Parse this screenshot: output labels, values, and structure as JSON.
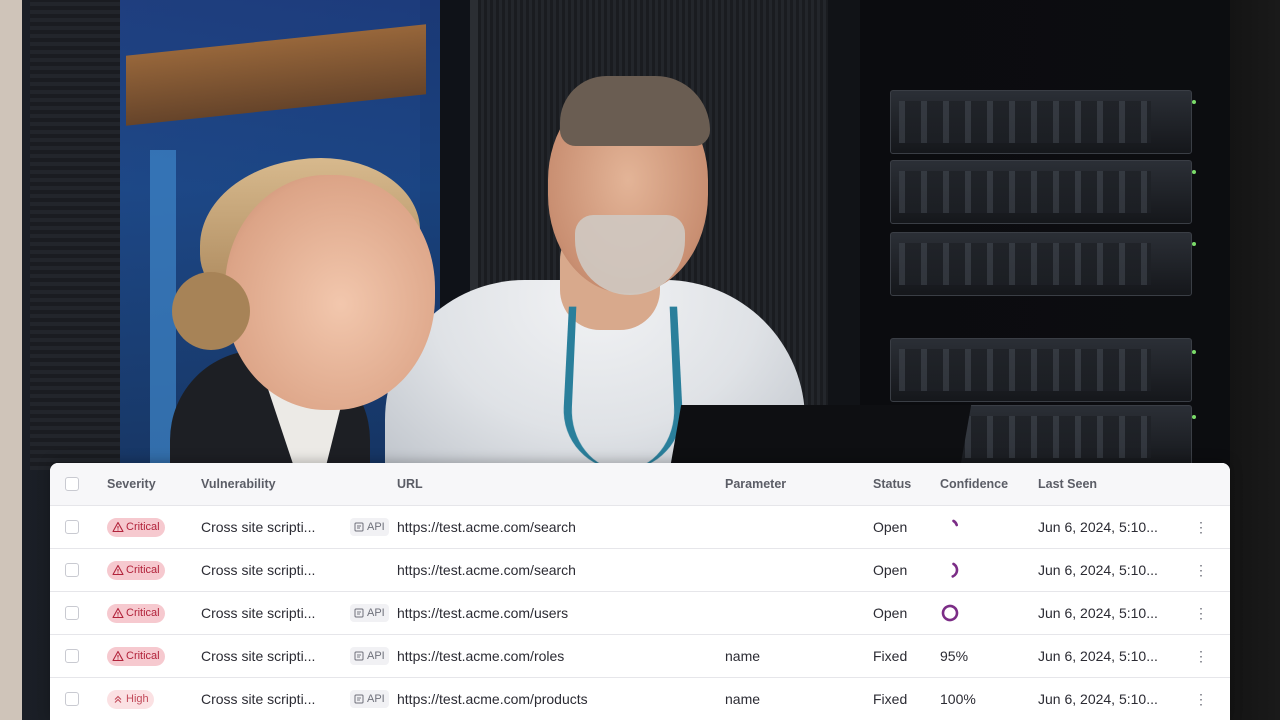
{
  "table": {
    "columns": {
      "severity": "Severity",
      "vulnerability": "Vulnerability",
      "url": "URL",
      "parameter": "Parameter",
      "status": "Status",
      "confidence": "Confidence",
      "last_seen": "Last Seen"
    },
    "rows": [
      {
        "severity": "Critical",
        "vulnerability": "Cross site scripti...",
        "api": "API",
        "url": "https://test.acme.com/search",
        "parameter": "",
        "status": "Open",
        "confidence": "",
        "confidence_progress": 0.12,
        "last_seen": "Jun 6, 2024, 5:10..."
      },
      {
        "severity": "Critical",
        "vulnerability": "Cross site scripti...",
        "api": "",
        "url": "https://test.acme.com/search",
        "parameter": "",
        "status": "Open",
        "confidence": "",
        "confidence_progress": 0.35,
        "last_seen": "Jun 6, 2024, 5:10..."
      },
      {
        "severity": "Critical",
        "vulnerability": "Cross site scripti...",
        "api": "API",
        "url": "https://test.acme.com/users",
        "parameter": "",
        "status": "Open",
        "confidence": "",
        "confidence_progress": 1.0,
        "last_seen": "Jun 6, 2024, 5:10..."
      },
      {
        "severity": "Critical",
        "vulnerability": "Cross site scripti...",
        "api": "API",
        "url": "https://test.acme.com/roles",
        "parameter": "name",
        "status": "Fixed",
        "confidence": "95%",
        "confidence_progress": null,
        "last_seen": "Jun 6, 2024, 5:10..."
      },
      {
        "severity": "High",
        "vulnerability": "Cross site scripti...",
        "api": "API",
        "url": "https://test.acme.com/products",
        "parameter": "name",
        "status": "Fixed",
        "confidence": "100%",
        "confidence_progress": null,
        "last_seen": "Jun 6, 2024, 5:10..."
      }
    ]
  },
  "icons": {
    "critical": "warning-triangle-icon",
    "high": "double-chevron-up-icon",
    "api": "api-doc-icon",
    "more": "vertical-ellipsis-icon"
  },
  "colors": {
    "critical_bg": "#f6c9cf",
    "critical_text": "#b2233b",
    "high_bg": "#fbe1e3",
    "high_text": "#c24a5a",
    "spinner": "#7b2d86"
  }
}
